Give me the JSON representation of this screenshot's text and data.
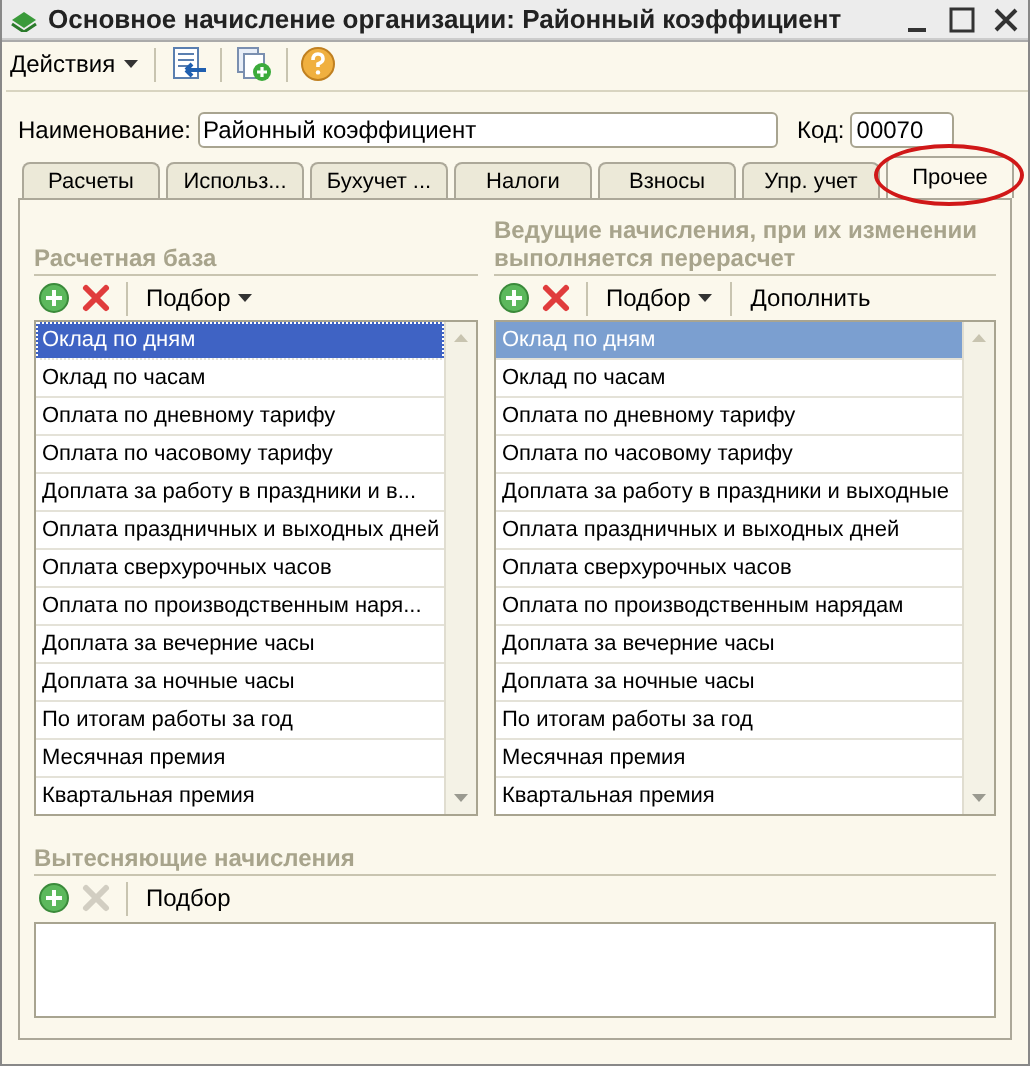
{
  "window": {
    "title": "Основное начисление организации: Районный коэффициент"
  },
  "toolbar": {
    "menu": "Действия"
  },
  "form": {
    "name_label": "Наименование:",
    "name_value": "Районный коэффициент",
    "code_label": "Код:",
    "code_value": "00070"
  },
  "tabs": [
    {
      "label": "Расчеты",
      "selected": false,
      "circled": false
    },
    {
      "label": "Использ...",
      "selected": false,
      "circled": false
    },
    {
      "label": "Бухучет ...",
      "selected": false,
      "circled": false
    },
    {
      "label": "Налоги",
      "selected": false,
      "circled": false
    },
    {
      "label": "Взносы",
      "selected": false,
      "circled": false
    },
    {
      "label": "Упр. учет",
      "selected": false,
      "circled": false
    },
    {
      "label": "Прочее",
      "selected": true,
      "circled": true
    }
  ],
  "lists": [
    {
      "title": "Расчетная база",
      "focused": true,
      "tools": [
        {
          "kind": "add"
        },
        {
          "kind": "delete",
          "disabled": false
        },
        {
          "kind": "menu",
          "label": "Подбор"
        }
      ],
      "rows": [
        {
          "text": "Оклад по дням",
          "selected": true
        },
        {
          "text": "Оклад по часам",
          "selected": false
        },
        {
          "text": "Оплата по дневному тарифу",
          "selected": false
        },
        {
          "text": "Оплата по часовому тарифу",
          "selected": false
        },
        {
          "text": "Доплата за работу в праздники и в...",
          "selected": false
        },
        {
          "text": "Оплата праздничных и выходных дней",
          "selected": false
        },
        {
          "text": "Оплата сверхурочных часов",
          "selected": false
        },
        {
          "text": "Оплата по производственным наря...",
          "selected": false
        },
        {
          "text": "Доплата за вечерние часы",
          "selected": false
        },
        {
          "text": "Доплата за ночные часы",
          "selected": false
        },
        {
          "text": "По итогам работы за год",
          "selected": false
        },
        {
          "text": "Месячная премия",
          "selected": false
        },
        {
          "text": "Квартальная премия",
          "selected": false
        }
      ]
    },
    {
      "title": "Ведущие начисления, при их изменении выполняется перерасчет",
      "focused": false,
      "tools": [
        {
          "kind": "add"
        },
        {
          "kind": "delete",
          "disabled": false
        },
        {
          "kind": "menu",
          "label": "Подбор"
        },
        {
          "kind": "button",
          "label": "Дополнить"
        }
      ],
      "rows": [
        {
          "text": "Оклад по дням",
          "selected": true
        },
        {
          "text": "Оклад по часам",
          "selected": false
        },
        {
          "text": "Оплата по дневному тарифу",
          "selected": false
        },
        {
          "text": "Оплата по часовому тарифу",
          "selected": false
        },
        {
          "text": "Доплата за работу в праздники и выходные",
          "selected": false
        },
        {
          "text": "Оплата праздничных и выходных дней",
          "selected": false
        },
        {
          "text": "Оплата сверхурочных часов",
          "selected": false
        },
        {
          "text": "Оплата по производственным нарядам",
          "selected": false
        },
        {
          "text": "Доплата за вечерние часы",
          "selected": false
        },
        {
          "text": "Доплата за ночные часы",
          "selected": false
        },
        {
          "text": "По итогам работы за год",
          "selected": false
        },
        {
          "text": "Месячная премия",
          "selected": false
        },
        {
          "text": "Квартальная премия",
          "selected": false
        }
      ]
    }
  ],
  "bottom_list": {
    "title": "Вытесняющие начисления",
    "tools": [
      {
        "kind": "add"
      },
      {
        "kind": "delete",
        "disabled": true
      },
      {
        "kind": "button",
        "label": "Подбор"
      }
    ]
  }
}
